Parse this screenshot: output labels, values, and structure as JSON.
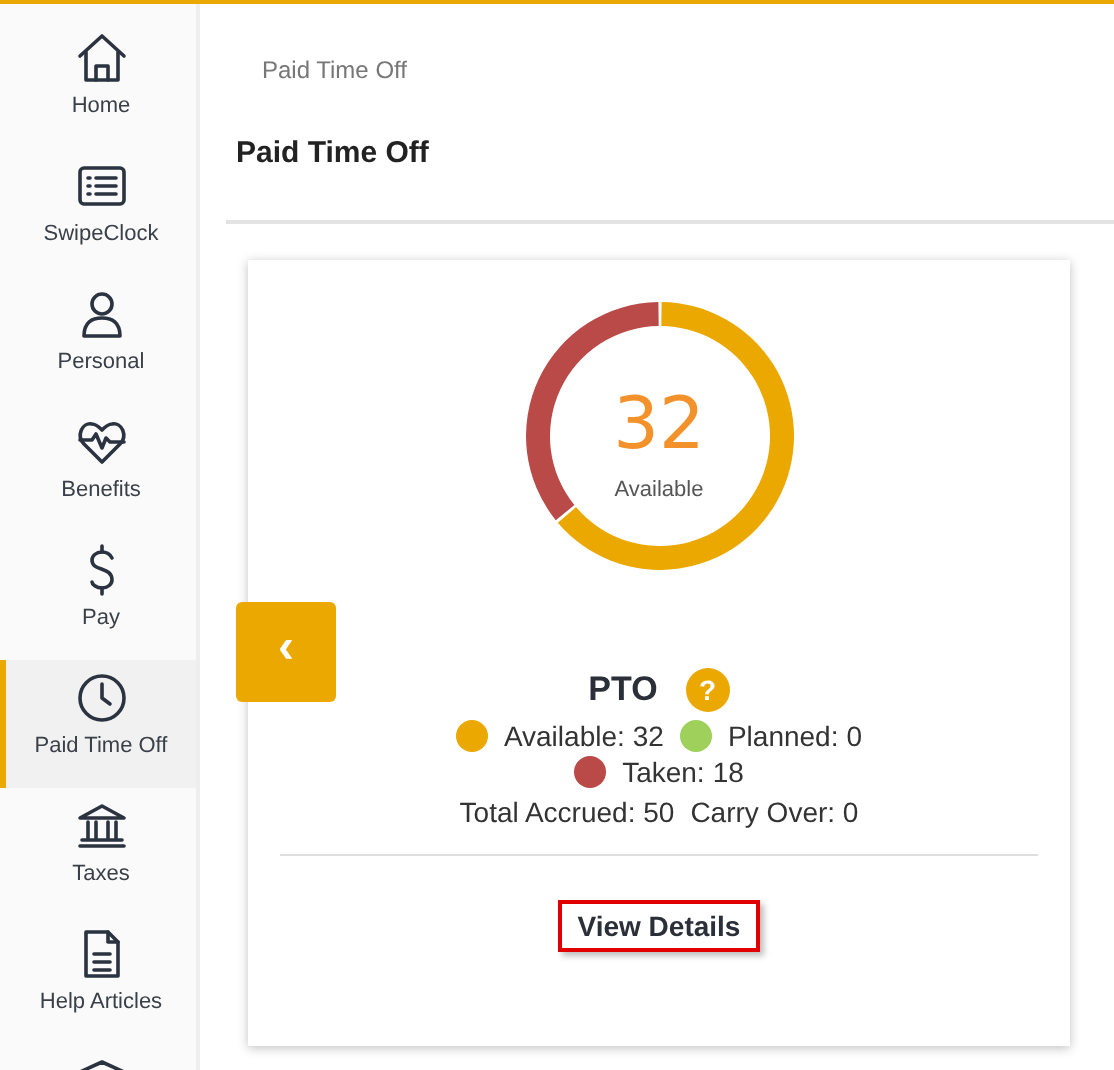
{
  "sidebar": {
    "items": [
      {
        "kind": "home",
        "label": "Home",
        "selected": false
      },
      {
        "kind": "list",
        "label": "SwipeClock",
        "selected": false
      },
      {
        "kind": "person",
        "label": "Personal",
        "selected": false
      },
      {
        "kind": "heart",
        "label": "Benefits",
        "selected": false
      },
      {
        "kind": "dollar",
        "label": "Pay",
        "selected": false
      },
      {
        "kind": "clock",
        "label": "Paid Time Off",
        "selected": true
      },
      {
        "kind": "bank",
        "label": "Taxes",
        "selected": false
      },
      {
        "kind": "document",
        "label": "Help Articles",
        "selected": false
      },
      {
        "kind": "box",
        "selected": false
      }
    ]
  },
  "breadcrumb": "Paid Time Off",
  "title": "Paid Time Off",
  "card": {
    "prev_button": "‹",
    "plan_name": "PTO",
    "legend": [
      {
        "label": "Available:",
        "value": "32",
        "color": "#eba800"
      },
      {
        "label": "Planned:",
        "value": "0",
        "color": "#9fd05b"
      },
      {
        "label": "Taken:",
        "value": "18",
        "color": "#b94a48"
      }
    ],
    "center_value": "32",
    "center_label": "Available",
    "help": "?",
    "totals": [
      "Total Accrued: 50",
      "Carry Over: 0"
    ],
    "details_button": "View Details"
  }
}
